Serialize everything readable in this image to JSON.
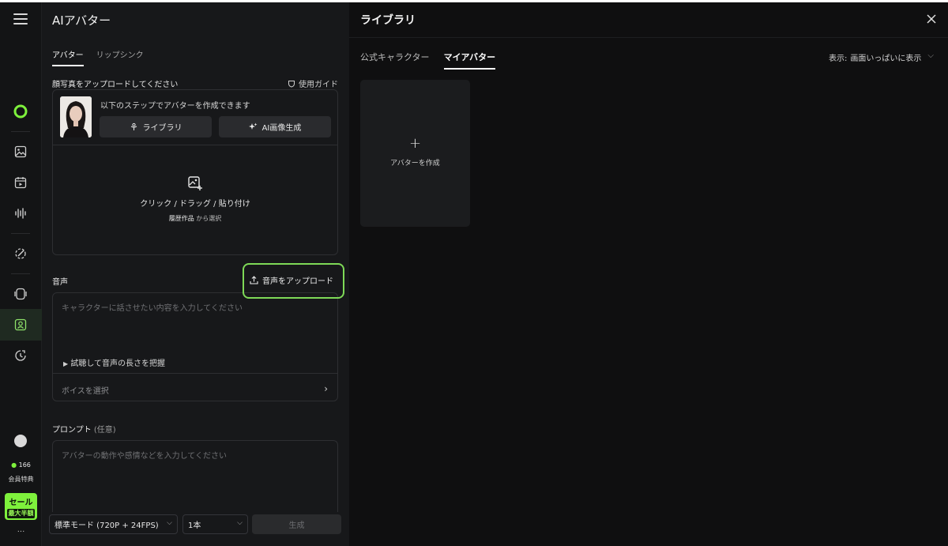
{
  "app": {
    "credits": "166",
    "member_label": "会員特典",
    "sale_top": "セール",
    "sale_bottom": "最大半額",
    "more": "..."
  },
  "panel": {
    "title": "AIアバター",
    "tabs": [
      "アバター",
      "リップシンク"
    ],
    "photo_section": {
      "label": "顔写真をアップロードしてください",
      "guide": "使用ガイド",
      "steps_text": "以下のステップでアバターを作成できます",
      "library_button": "ライブラリ",
      "ai_button": "AI画像生成",
      "drop_text": "クリック / ドラッグ / 貼り付け",
      "history_link": "履歴作品",
      "history_suffix": "から選択"
    },
    "audio_section": {
      "label": "音声",
      "upload_button": "音声をアップロード",
      "placeholder": "キャラクターに話させたい内容を入力してください",
      "listen": "試聴して音声の長さを把握",
      "voice_select": "ボイスを選択"
    },
    "prompt_section": {
      "label": "プロンプト",
      "optional": "(任意)",
      "placeholder": "アバターの動作や感情などを入力してください"
    },
    "footer": {
      "mode_select": "標準モード (720P + 24FPS)",
      "count_select": "1本",
      "generate_button": "生成"
    }
  },
  "library": {
    "title": "ライブラリ",
    "tabs": [
      "公式キャラクター",
      "マイアバター"
    ],
    "active_tab": "マイアバター",
    "display_label": "表示:",
    "display_value": "画面いっぱいに表示",
    "create_label": "アバターを作成",
    "create_plus": "+"
  },
  "colors": {
    "accent_green": "#7ed957",
    "sale_green": "#7ef13c",
    "background": "#0f0f10",
    "panel": "#17181a"
  }
}
